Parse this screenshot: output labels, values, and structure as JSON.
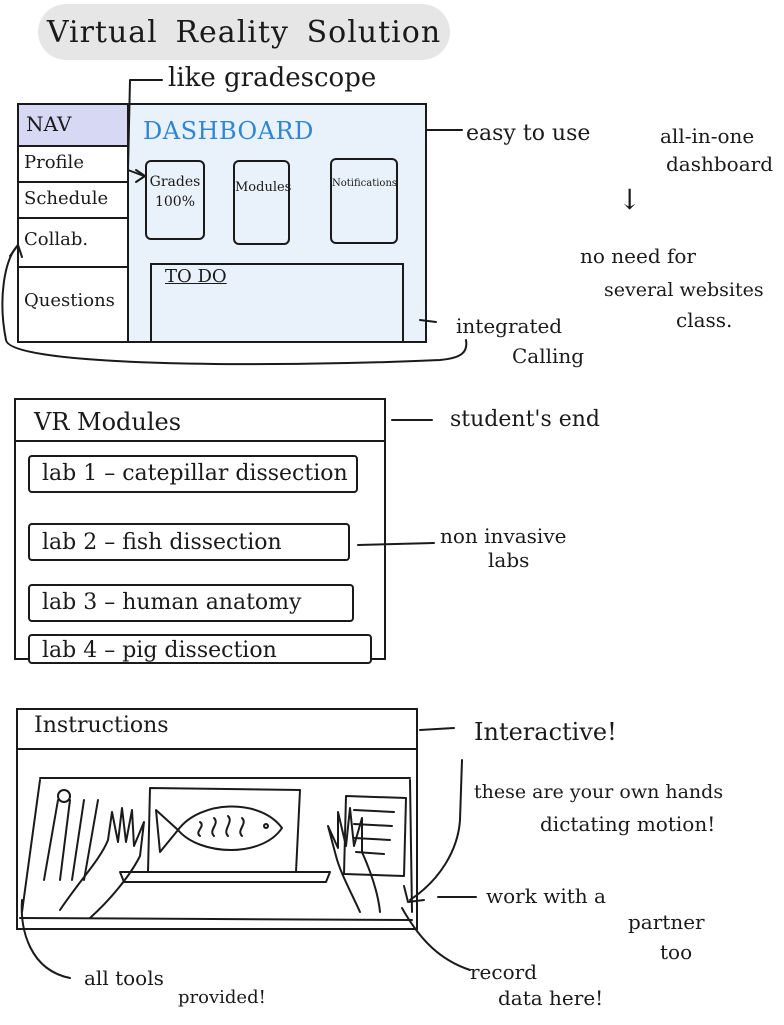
{
  "title": [
    "Virtual",
    "Reality",
    "Solution"
  ],
  "sketch1": {
    "top_note": "like gradescope",
    "nav_header": "NAV",
    "nav_items": [
      "Profile",
      "Schedule",
      "Collab.",
      "Questions"
    ],
    "dashboard_title": "DASHBOARD",
    "cards": [
      {
        "label": "Grades",
        "value": "100%"
      },
      {
        "label": "Modules",
        "value": ""
      },
      {
        "label": "Notifications",
        "value": ""
      }
    ],
    "todo_title": "TO DO",
    "notes": {
      "easy": "easy to use",
      "all_in_one_1": "all-in-one",
      "all_in_one_2": "dashboard",
      "arrow": "↓",
      "no_need_1": "no need   for",
      "no_need_2": "several   websites",
      "no_need_3": "class.",
      "calling_1": "integrated",
      "calling_2": "Calling"
    },
    "colors": {
      "dashboard_title": "#2f86d4",
      "dashboard_bg": "#e9f1fb",
      "nav_header_bg": "#d6d8f4"
    }
  },
  "sketch2": {
    "title": "VR Modules",
    "labs": [
      "lab 1 – catepillar dissection",
      "lab 2 – fish dissection",
      "lab 3 – human anatomy",
      "lab 4 – pig dissection"
    ],
    "notes": {
      "students": "student's end",
      "non_invasive_1": "non invasive",
      "non_invasive_2": "labs"
    }
  },
  "sketch3": {
    "title": "Instructions",
    "notes": {
      "interactive": "Interactive!",
      "hands_1": "these are your own hands",
      "hands_2": "dictating motion!",
      "partner_1": "work with a",
      "partner_2": "partner",
      "partner_3": "too",
      "record_1": "record",
      "record_2": "data here!",
      "tools_1": "all tools",
      "tools_2": "provided!"
    }
  }
}
